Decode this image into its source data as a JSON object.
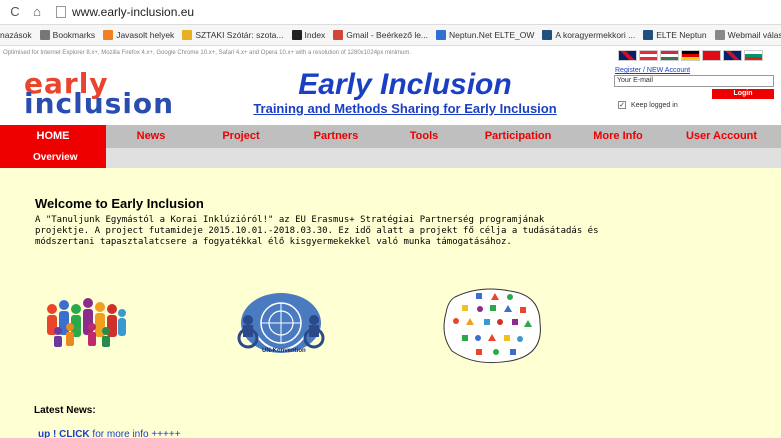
{
  "browser": {
    "url": "www.early-inclusion.eu",
    "back_icon": "back-arrow-icon",
    "home_icon": "home-icon",
    "bookmarks": [
      {
        "label": "nazások",
        "color": "#ffffff"
      },
      {
        "label": "Bookmarks",
        "color": "#777777"
      },
      {
        "label": "Javasolt helyek",
        "color": "#f08020"
      },
      {
        "label": "SZTAKI Szótár: szota...",
        "color": "#e8b020"
      },
      {
        "label": "Index",
        "color": "#222222"
      },
      {
        "label": "Gmail - Beérkező le...",
        "color": "#d44638"
      },
      {
        "label": "Neptun.Net ELTE_OW",
        "color": "#3070d0"
      },
      {
        "label": "A koragyermekkori ...",
        "color": "#205080"
      },
      {
        "label": "ELTE Neptun",
        "color": "#205080"
      },
      {
        "label": "Webmail választás",
        "color": "#888888"
      }
    ]
  },
  "site": {
    "info_bar": "Optimised for Internet Explorer 8.x+, Mozilla Firefox 4.x+, Google Chrome 10.x+, Safari 4.x+ and Opera 10.x+ with a resolution of 1280x1024px minimum.",
    "logo_line1": "early",
    "logo_line2": "inclusion",
    "title": "Early Inclusion",
    "subtitle": "Training and Methods Sharing for Early Inclusion",
    "login": {
      "register_link": "Register / NEW Account",
      "email_placeholder": "Your E-mail",
      "login_button": "Login",
      "keep_logged_in": "Keep logged in",
      "keep_logged_in_checked": true
    },
    "flags": [
      {
        "name": "uk-flag"
      },
      {
        "name": "austria-flag"
      },
      {
        "name": "hungary-flag"
      },
      {
        "name": "germany-flag"
      },
      {
        "name": "turkey-flag"
      },
      {
        "name": "uk-flag-2"
      },
      {
        "name": "bulgaria-flag"
      }
    ],
    "nav": [
      {
        "label": "HOME",
        "active": true
      },
      {
        "label": "News",
        "active": false
      },
      {
        "label": "Project",
        "active": false
      },
      {
        "label": "Partners",
        "active": false
      },
      {
        "label": "Tools",
        "active": false
      },
      {
        "label": "Participation",
        "active": false
      },
      {
        "label": "More Info",
        "active": false
      },
      {
        "label": "User Account",
        "active": false
      }
    ],
    "subnav": "Overview",
    "welcome_title": "Welcome to Early Inclusion",
    "welcome_text": "A \"Tanuljunk Egymástól a Korai Inklúzióról!\" az EU Erasmus+ Stratégiai Partnerség programjának projektje. A project futamideje 2015.10.01.-2018.03.30. Ez idő alatt a projekt fő célja a tudásátadás és módszertani tapasztalatcsere a fogyatékkal élő kisgyermekekkel való munka támogatásához.",
    "un_label": "UN-Konvention",
    "latest_news_title": "Latest News:",
    "latest_news_link_up": "up ! CLICK",
    "latest_news_link_rest": " for more info +++++",
    "colors": {
      "accent_red": "#ee0000",
      "title_blue": "#1a3fc4",
      "content_bg": "#ffffd4"
    }
  }
}
